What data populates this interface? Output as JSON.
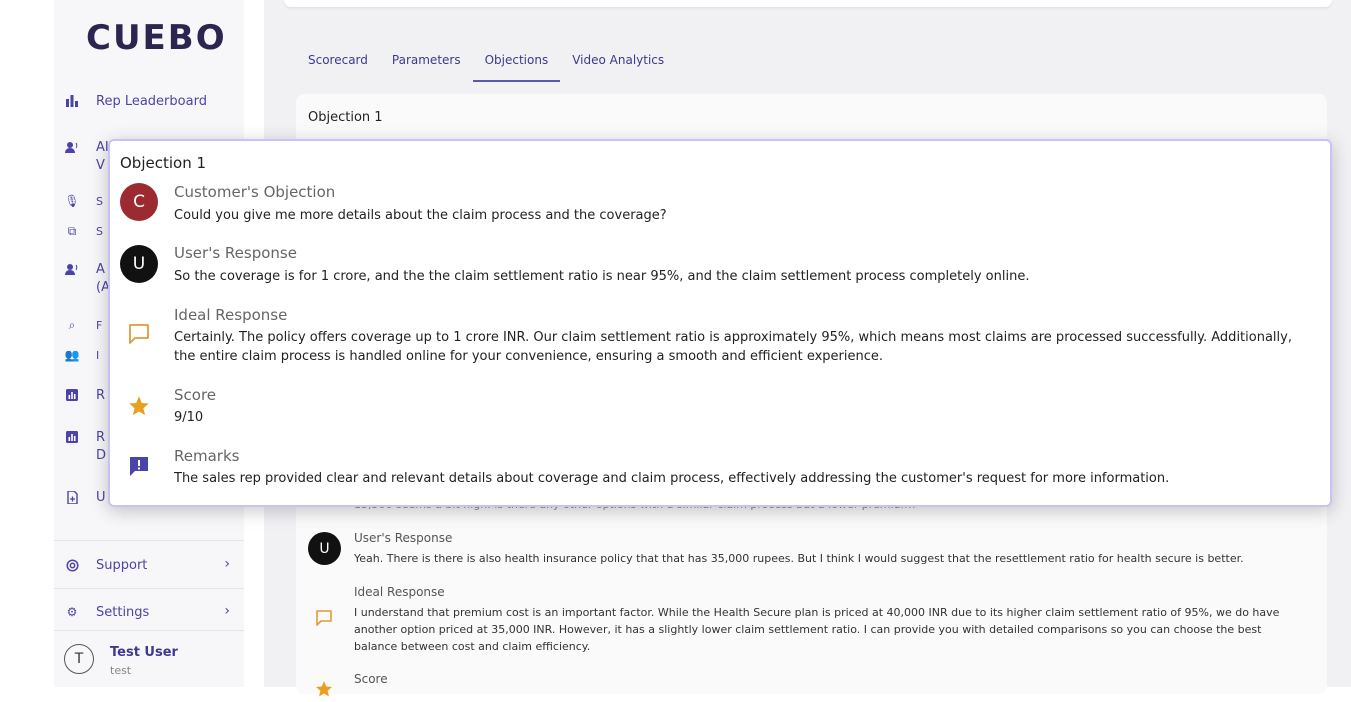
{
  "app": {
    "logo": "CUEBO"
  },
  "sidebar": {
    "items": [
      {
        "label": "Rep Leaderboard",
        "icon": "bar-chart-icon"
      },
      {
        "label": "AI",
        "icon": "voice-user-icon"
      },
      {
        "label": "V",
        "icon": ""
      },
      {
        "label": "S",
        "icon": "mic-icon"
      },
      {
        "label": "S",
        "icon": "copy-icon"
      },
      {
        "label": "A",
        "icon": "voice-user-icon"
      },
      {
        "label": "(A",
        "icon": ""
      },
      {
        "label": "F",
        "icon": "search-zoom-icon"
      },
      {
        "label": "I",
        "icon": "group-icon"
      },
      {
        "label": "R",
        "icon": "report-icon"
      },
      {
        "label": "R",
        "icon": "report-icon"
      },
      {
        "label": "D",
        "icon": ""
      },
      {
        "label": "U",
        "icon": "document-icon"
      }
    ],
    "support": "Support",
    "settings": "Settings",
    "user": {
      "initial": "T",
      "name": "Test User",
      "sub": "test"
    }
  },
  "tabs": [
    "Scorecard",
    "Parameters",
    "Objections",
    "Video Analytics"
  ],
  "active_tab": "Objections",
  "card": {
    "title": "Objection 1",
    "partial_text": "15,500 seems a bit high. Is there any other options with a similar claim process but a lower premium?",
    "users_response_label": "User's Response",
    "users_response_initial": "U",
    "users_response": "Yeah. There is there is also health insurance policy that that has 35,000 rupees. But I think I would suggest that the resettlement ratio for health secure is better.",
    "ideal_response_label": "Ideal Response",
    "ideal_response": "I understand that premium cost is an important factor. While the Health Secure plan is priced at 40,000 INR due to its higher claim settlement ratio of 95%, we do have another option priced at 35,000 INR. However, it has a slightly lower claim settlement ratio. I can provide you with detailed comparisons so you can choose the best balance between cost and claim efficiency.",
    "score_label": "Score"
  },
  "popup": {
    "title": "Objection 1",
    "customer_label": "Customer's Objection",
    "customer_initial": "C",
    "customer_text": "Could you give me more details about the claim process and the coverage?",
    "user_label": "User's Response",
    "user_initial": "U",
    "user_text": "So the coverage is for 1 crore, and the the claim settlement ratio is near 95%, and the claim settlement process completely online.",
    "ideal_label": "Ideal Response",
    "ideal_text": "Certainly. The policy offers coverage up to 1 crore INR. Our claim settlement ratio is approximately 95%, which means most claims are processed successfully. Additionally, the entire claim process is handled online for your convenience, ensuring a smooth and efficient experience.",
    "score_label": "Score",
    "score_value": "9/10",
    "remarks_label": "Remarks",
    "remarks_text": "The sales rep provided clear and relevant details about coverage and claim process, effectively addressing the customer's request for more information."
  },
  "colors": {
    "accent": "#4b44a8",
    "customer": "#9b2b30",
    "user": "#111111",
    "star": "#e8a020",
    "remarks": "#4b44a8",
    "ideal": "#e09a3a"
  }
}
